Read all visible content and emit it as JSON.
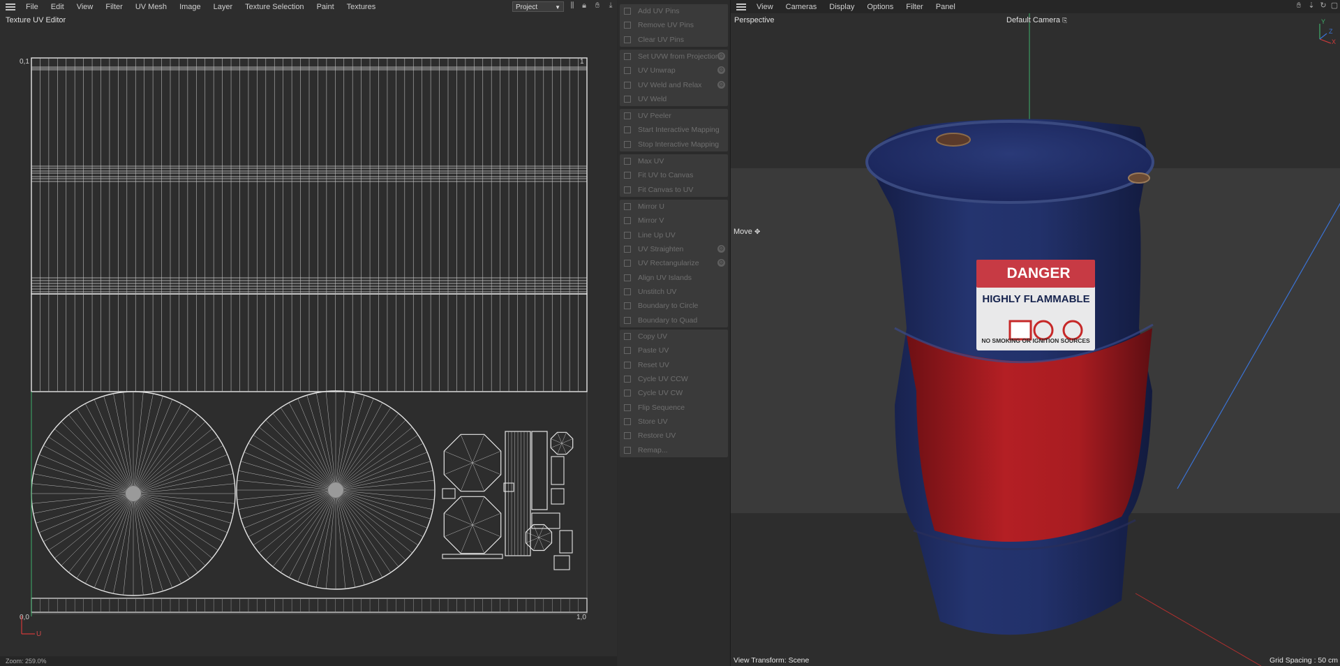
{
  "menubar": {
    "items": [
      "File",
      "Edit",
      "View",
      "Filter",
      "UV Mesh",
      "Image",
      "Layer",
      "Texture Selection",
      "Paint",
      "Textures"
    ],
    "project_select": "Project"
  },
  "uv_editor": {
    "title": "Texture UV Editor",
    "corner_top_left": "0,1",
    "corner_top_right": "1",
    "corner_bottom_left": "0,0",
    "corner_bottom_right": "1,0",
    "axis_u": "U",
    "zoom": "Zoom: 259.0%"
  },
  "commands": {
    "groups": [
      [
        {
          "label": "Add UV Pins"
        },
        {
          "label": "Remove UV Pins"
        },
        {
          "label": "Clear UV Pins"
        }
      ],
      [
        {
          "label": "Set UVW from Projection",
          "gear": true
        },
        {
          "label": "UV Unwrap",
          "gear": true
        },
        {
          "label": "UV Weld and Relax",
          "gear": true
        },
        {
          "label": "UV Weld"
        }
      ],
      [
        {
          "label": "UV Peeler"
        },
        {
          "label": "Start Interactive Mapping"
        },
        {
          "label": "Stop Interactive Mapping"
        }
      ],
      [
        {
          "label": "Max UV"
        },
        {
          "label": "Fit UV to Canvas"
        },
        {
          "label": "Fit Canvas to UV"
        }
      ],
      [
        {
          "label": "Mirror U"
        },
        {
          "label": "Mirror V"
        },
        {
          "label": "Line Up UV"
        },
        {
          "label": "UV Straighten",
          "gear": true
        },
        {
          "label": "UV Rectangularize",
          "gear": true
        },
        {
          "label": "Align UV Islands"
        },
        {
          "label": "Unstitch UV"
        },
        {
          "label": "Boundary to Circle"
        },
        {
          "label": "Boundary to Quad"
        }
      ],
      [
        {
          "label": "Copy UV"
        },
        {
          "label": "Paste UV"
        },
        {
          "label": "Reset UV"
        },
        {
          "label": "Cycle UV CCW"
        },
        {
          "label": "Cycle UV CW"
        },
        {
          "label": "Flip Sequence"
        },
        {
          "label": "Store UV"
        },
        {
          "label": "Restore UV"
        },
        {
          "label": "Remap..."
        }
      ]
    ]
  },
  "viewport": {
    "menu": [
      "View",
      "Cameras",
      "Display",
      "Options",
      "Filter",
      "Panel"
    ],
    "title": "Perspective",
    "camera": "Default Camera",
    "move_label": "Move",
    "view_transform": "View Transform: Scene",
    "grid_spacing": "Grid Spacing : 50 cm",
    "axis_labels": {
      "x": "X",
      "y": "Y",
      "z": "Z"
    },
    "label": {
      "danger": "DANGER",
      "flammable": "HIGHLY FLAMMABLE",
      "warning": "NO SMOKING OR IGNITION SOURCES"
    },
    "colors": {
      "barrel_blue": "#1f2d6b",
      "barrel_red": "#b01e22",
      "grid_line": "#3a73d6",
      "y_axis": "#3fae6a"
    }
  }
}
